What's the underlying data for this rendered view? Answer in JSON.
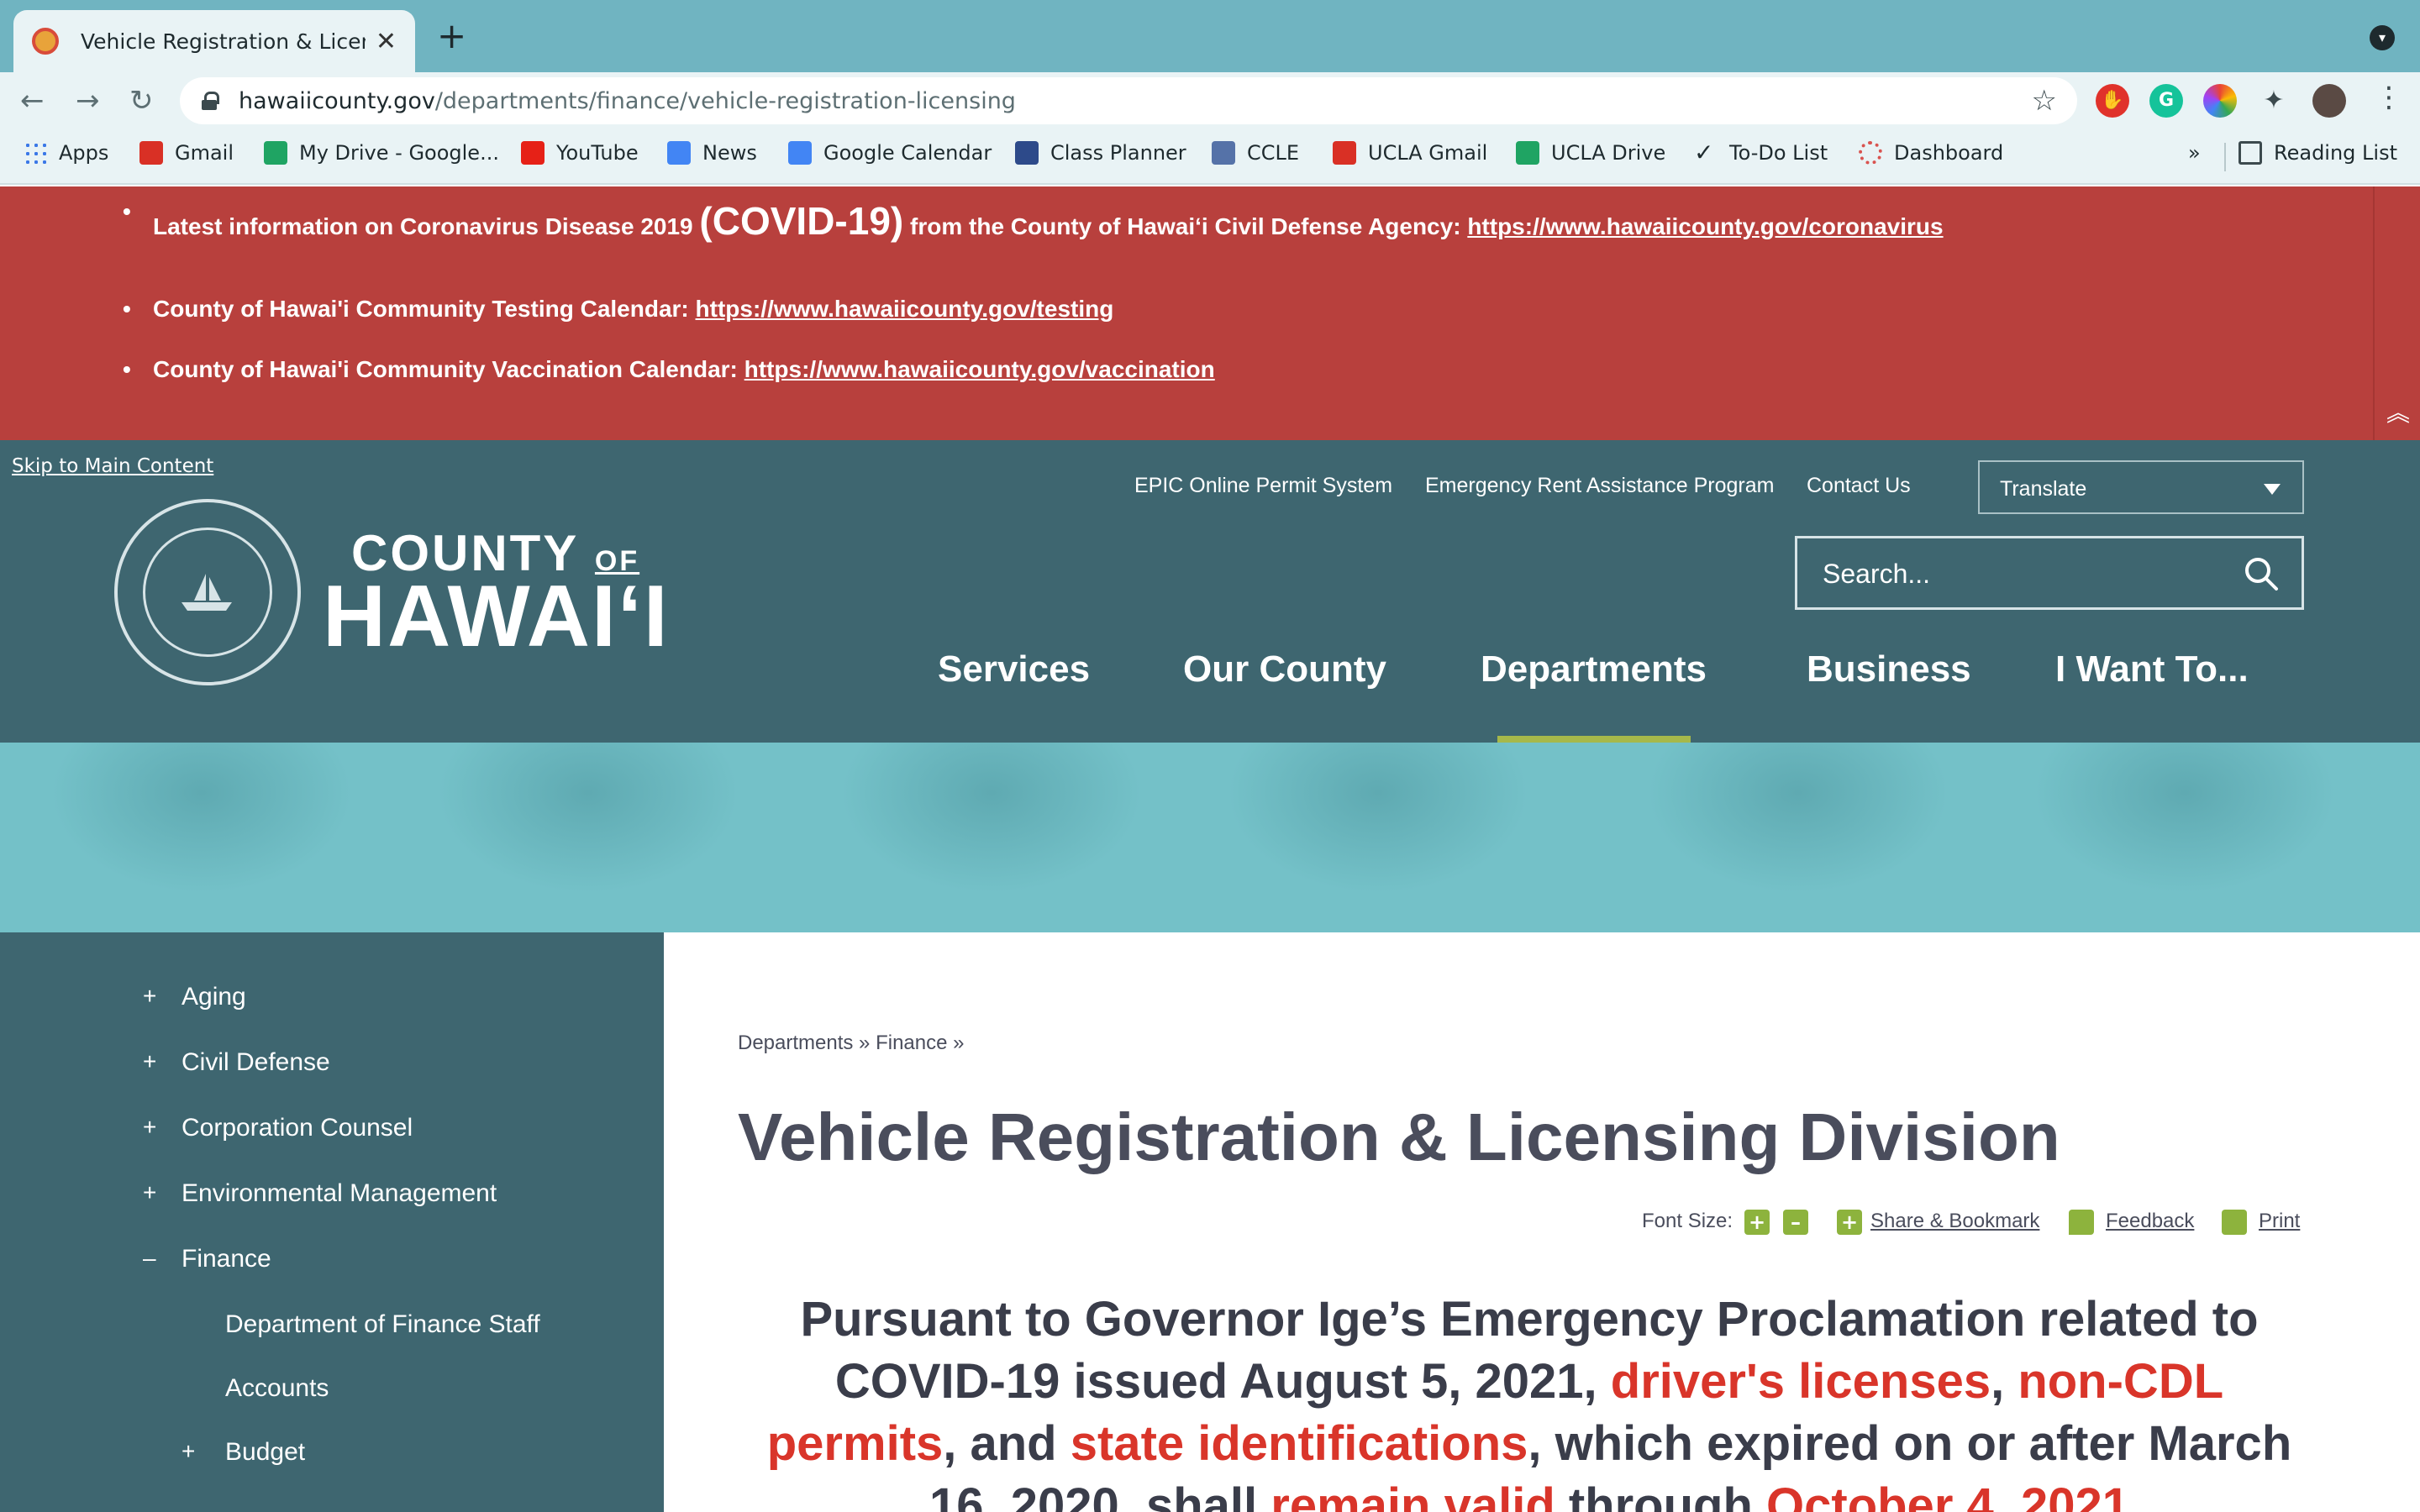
{
  "browser": {
    "tab_title": "Vehicle Registration & Licensing",
    "new_tab": "+",
    "url_host": "hawaiicounty.gov",
    "url_path": "/departments/finance/vehicle-registration-licensing",
    "bookmarks": [
      {
        "label": "Apps",
        "icon": "apps-grid-icon",
        "color": "#3b78e7"
      },
      {
        "label": "Gmail",
        "icon": "gmail-icon",
        "color": "#d93025"
      },
      {
        "label": "My Drive - Google...",
        "icon": "drive-icon",
        "color": "#1fa463"
      },
      {
        "label": "YouTube",
        "icon": "youtube-icon",
        "color": "#e62117"
      },
      {
        "label": "News",
        "icon": "news-icon",
        "color": "#4285f4"
      },
      {
        "label": "Google Calendar",
        "icon": "calendar-icon",
        "color": "#4285f4"
      },
      {
        "label": "Class Planner",
        "icon": "ucla-icon",
        "color": "#2d4a8a"
      },
      {
        "label": "CCLE",
        "icon": "ccle-icon",
        "color": "#5572a8"
      },
      {
        "label": "UCLA Gmail",
        "icon": "gmail-icon",
        "color": "#d93025"
      },
      {
        "label": "UCLA Drive",
        "icon": "drive-icon",
        "color": "#1fa463"
      },
      {
        "label": "To-Do List",
        "icon": "checkmark-icon",
        "color": "#1e2a2e"
      },
      {
        "label": "Dashboard",
        "icon": "dashboard-icon",
        "color": "#d9534f"
      }
    ],
    "more": "»",
    "reading_list": "Reading List"
  },
  "alert": {
    "line1_prefix": "Latest information on Coronavirus Disease 2019 ",
    "line1_big": "(COVID-19)",
    "line1_mid": " from the County of Hawaiʻi Civil Defense Agency: ",
    "line1_link": "https://www.hawaiicounty.gov/coronavirus",
    "line2_prefix": "County of Hawai'i Community Testing Calendar: ",
    "line2_link": "https://www.hawaiicounty.gov/testing",
    "line3_prefix": "County of Hawai'i Community Vaccination Calendar: ",
    "line3_link": "https://www.hawaiicounty.gov/vaccination",
    "color": "#b8403d"
  },
  "header": {
    "skip_link": "Skip to Main Content",
    "logo_county": "COUNTY",
    "logo_of": "OF",
    "logo_hawaii": "HAWAIʻI",
    "utility_links": [
      "EPIC Online Permit System",
      "Emergency Rent Assistance Program",
      "Contact Us"
    ],
    "translate": "Translate",
    "search_placeholder": "Search...",
    "nav": [
      "Services",
      "Our County",
      "Departments",
      "Business",
      "I Want To..."
    ],
    "active_nav": "Departments",
    "accent_color": "#a6b84a"
  },
  "sidebar": {
    "items": [
      {
        "sign": "+",
        "label": "Aging"
      },
      {
        "sign": "+",
        "label": "Civil Defense"
      },
      {
        "sign": "+",
        "label": "Corporation Counsel"
      },
      {
        "sign": "+",
        "label": "Environmental Management"
      },
      {
        "sign": "–",
        "label": "Finance"
      }
    ],
    "subitems": [
      {
        "sign": "",
        "label": "Department of Finance Staff"
      },
      {
        "sign": "",
        "label": "Accounts"
      },
      {
        "sign": "+",
        "label": "Budget"
      }
    ]
  },
  "main": {
    "breadcrumb": "Departments » Finance »",
    "title": "Vehicle Registration & Licensing Division",
    "font_size_label": "Font Size:",
    "share": "Share & Bookmark",
    "feedback": "Feedback",
    "print": "Print",
    "notice": {
      "p1": "Pursuant to Governor Ige’s Emergency Proclamation related to COVID-19 issued August 5, 2021, ",
      "r1": "driver's licenses",
      "p2": ", ",
      "r2": "non-CDL permits",
      "p3": ", and ",
      "r3": "state identifications",
      "p4": ", which expired on or after March 16, 2020, shall ",
      "r4": "remain valid",
      "p5": " through ",
      "r5": "October 4, 2021"
    }
  }
}
